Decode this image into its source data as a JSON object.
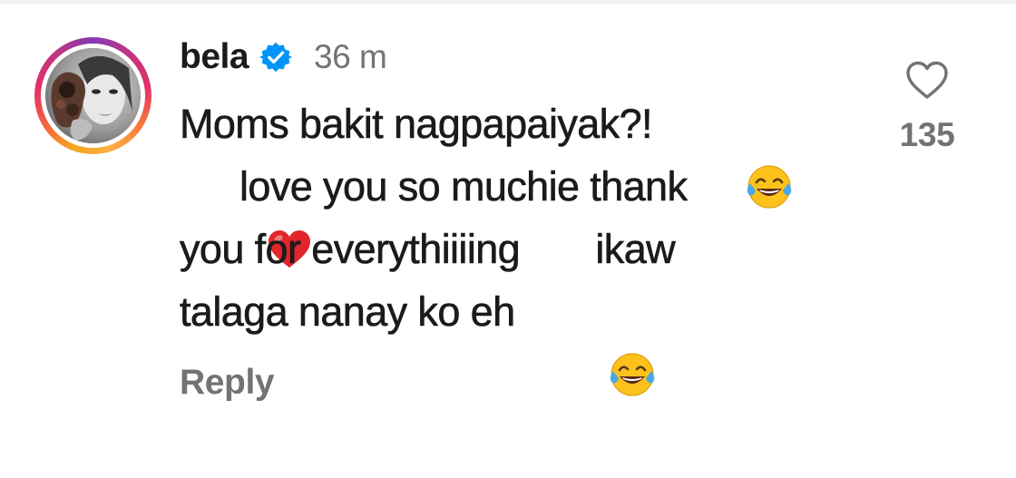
{
  "comment": {
    "username": "bela",
    "verified": true,
    "timestamp": "36 m",
    "lines": [
      {
        "text": "Moms bakit nagpapaiyak?!",
        "trailing_emoji": "face-with-tears-of-joy"
      },
      {
        "leading_emoji": "red-heart",
        "text": "love you so muchie thank"
      },
      {
        "text": "you for everythiiiing       ikaw"
      },
      {
        "text": "talaga nanay ko eh",
        "trailing_emoji": "face-with-tears-of-joy"
      }
    ],
    "reply_label": "Reply",
    "like_count": "135"
  },
  "colors": {
    "text_primary": "#1b1b1b",
    "text_secondary": "#737373",
    "verified_badge": "#0095f6",
    "heart_outline": "#737373"
  },
  "icons": {
    "verified": "verified-badge-icon",
    "like": "heart-outline-icon",
    "laugh": "face-with-tears-of-joy-emoji",
    "heart": "red-heart-emoji"
  }
}
